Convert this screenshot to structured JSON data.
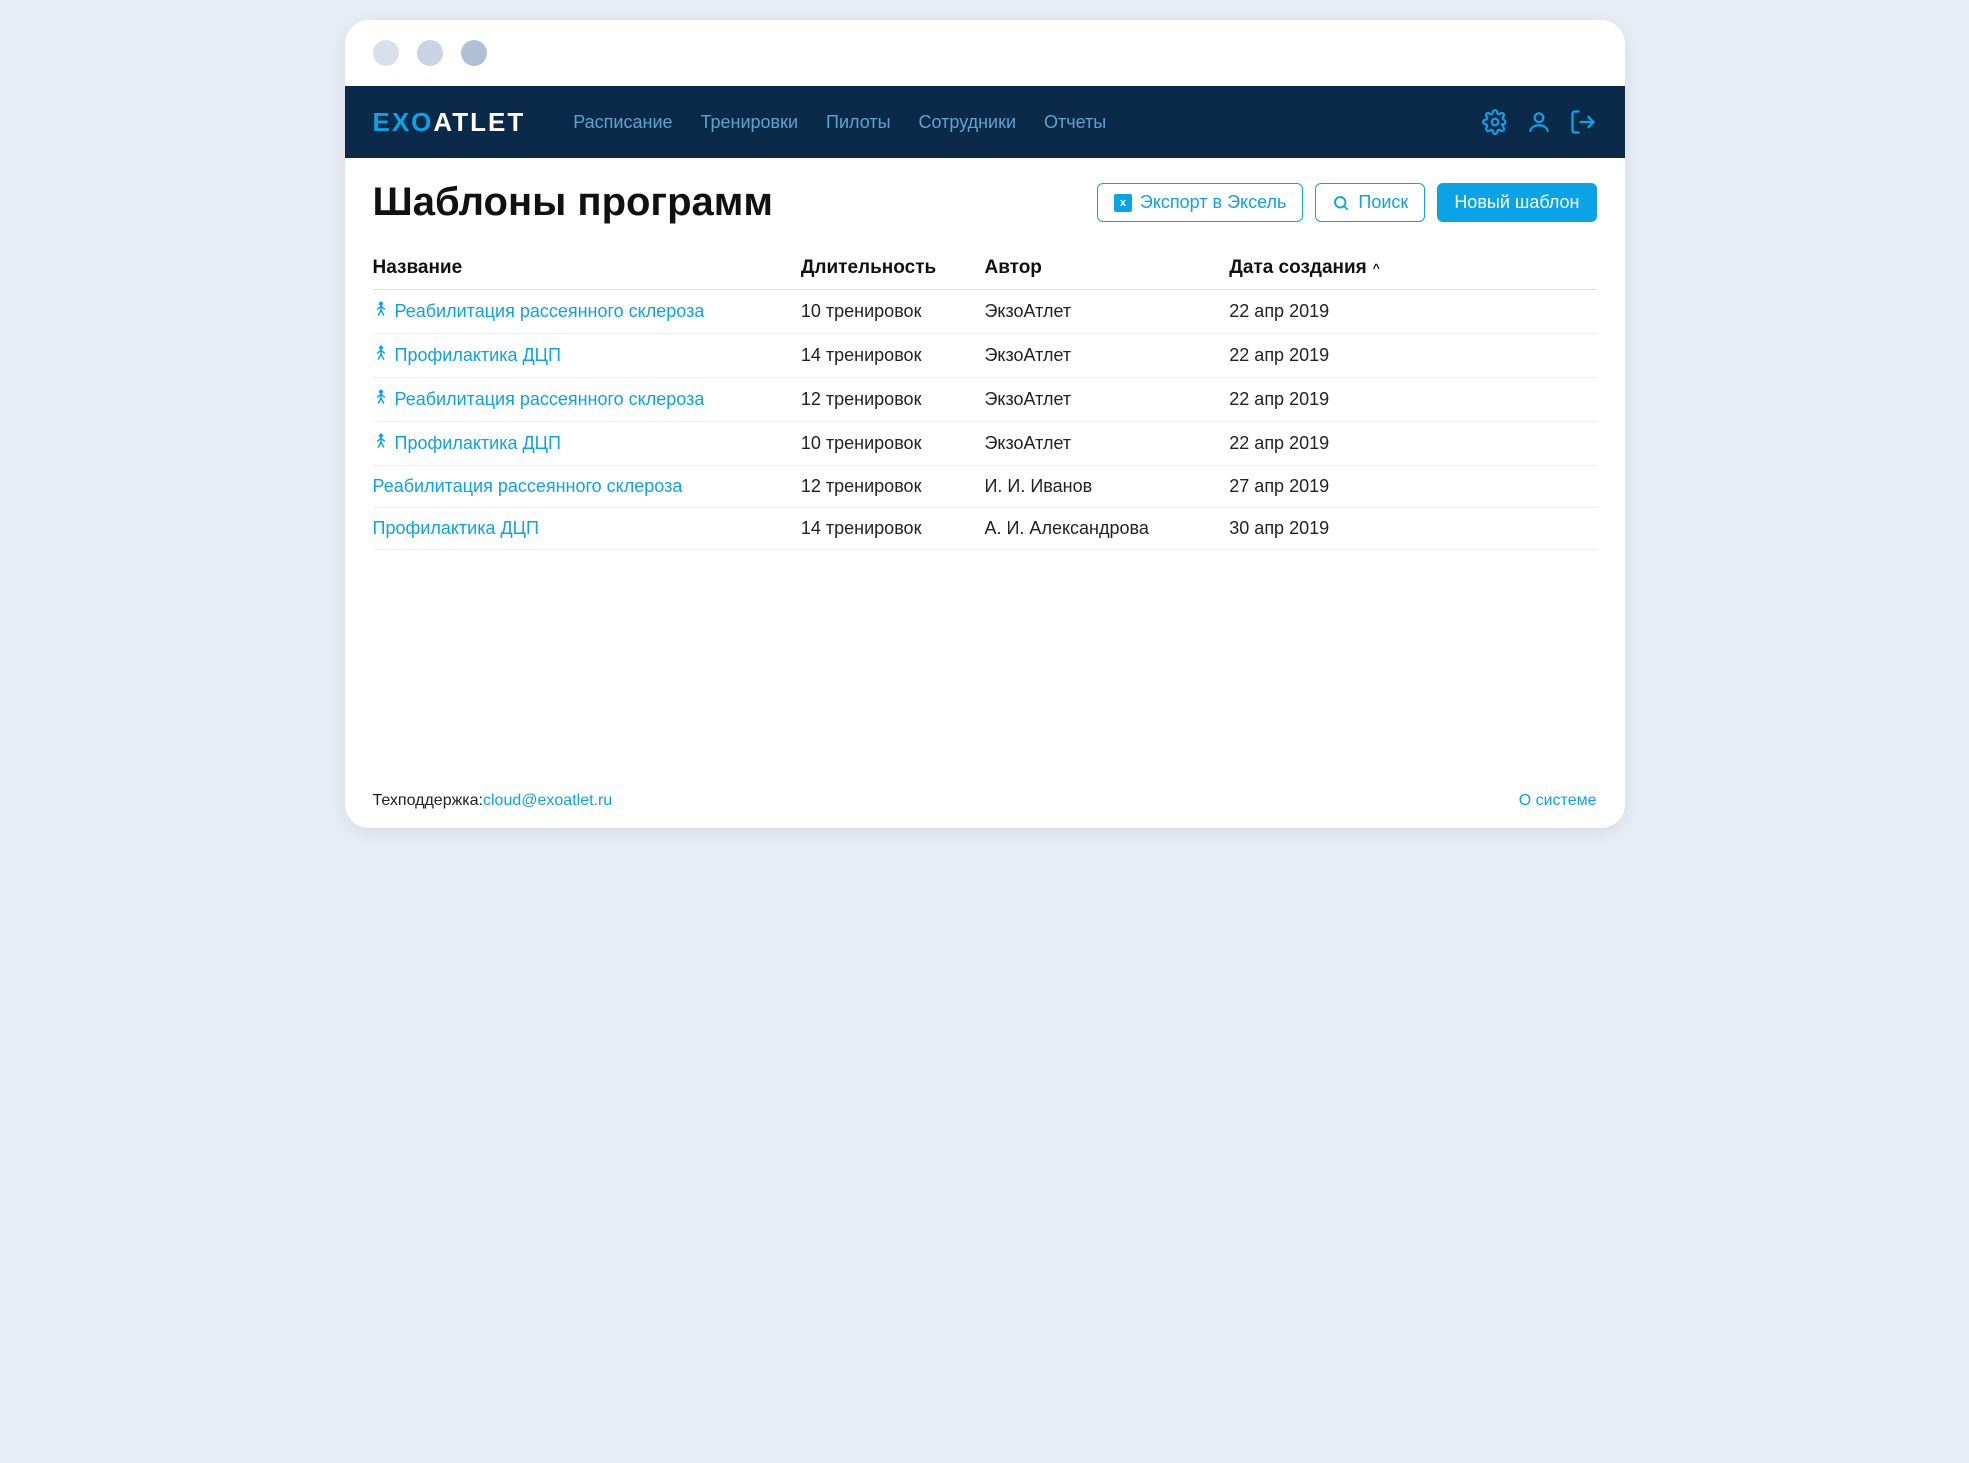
{
  "logo": {
    "left": "EXO",
    "right": "ATLET"
  },
  "nav": {
    "items": [
      {
        "label": "Расписание"
      },
      {
        "label": "Тренировки"
      },
      {
        "label": "Пилоты"
      },
      {
        "label": "Сотрудники"
      },
      {
        "label": "Отчеты"
      }
    ]
  },
  "page": {
    "title": "Шаблоны программ"
  },
  "actions": {
    "export": "Экспорт в Эксель",
    "search": "Поиск",
    "new": "Новый шаблон"
  },
  "table": {
    "headers": {
      "name": "Название",
      "duration": "Длительность",
      "author": "Автор",
      "date": "Дата создания"
    },
    "sort_indicator": "^",
    "rows": [
      {
        "has_icon": true,
        "name": "Реабилитация рассеянного склероза",
        "duration": "10 тренировок",
        "author": "ЭкзоАтлет",
        "date": "22 апр 2019"
      },
      {
        "has_icon": true,
        "name": "Профилактика ДЦП",
        "duration": "14 тренировок",
        "author": "ЭкзоАтлет",
        "date": "22 апр 2019"
      },
      {
        "has_icon": true,
        "name": "Реабилитация рассеянного склероза",
        "duration": "12 тренировок",
        "author": "ЭкзоАтлет",
        "date": "22 апр 2019"
      },
      {
        "has_icon": true,
        "name": "Профилактика ДЦП",
        "duration": "10 тренировок",
        "author": "ЭкзоАтлет",
        "date": "22 апр 2019"
      },
      {
        "has_icon": false,
        "name": "Реабилитация рассеянного склероза",
        "duration": "12 тренировок",
        "author": "И. И. Иванов",
        "date": "27 апр 2019"
      },
      {
        "has_icon": false,
        "name": "Профилактика ДЦП",
        "duration": "14 тренировок",
        "author": "А. И. Александрова",
        "date": "30 апр 2019"
      }
    ]
  },
  "footer": {
    "support_label": "Техподдержка: ",
    "support_email": "cloud@exoatlet.ru",
    "about": "О системе"
  }
}
